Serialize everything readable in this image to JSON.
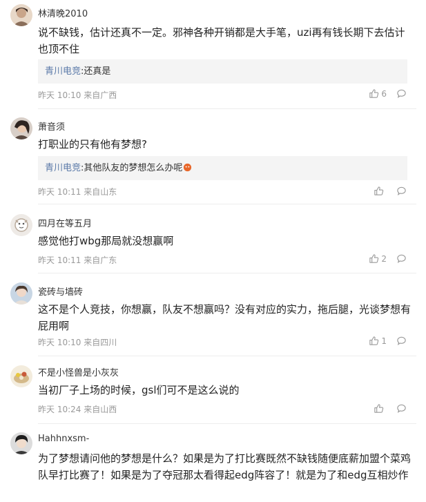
{
  "comments": [
    {
      "name": "林清晚2010",
      "text": "说不缺钱，估计还真不一定。邪神各种开销都是大手笔，uzi再有钱长期下去估计也顶不住",
      "reply": {
        "name": "青川电竞",
        "text": ":还真是"
      },
      "meta": "昨天 10:10 来自广西",
      "likes": "6",
      "avatar_color": "#c9a58a"
    },
    {
      "name": "萧音须",
      "text": "打职业的只有他有梦想?",
      "reply": {
        "name": "青川电竞",
        "text": ":其他队友的梦想怎么办呢"
      },
      "meta": "昨天 10:11 来自山东",
      "likes": "",
      "avatar_color": "#6b5a52"
    },
    {
      "name": "四月在等五月",
      "text": "感觉他打wbg那局就没想赢啊",
      "meta": "昨天 10:11 来自广东",
      "likes": "2",
      "avatar_color": "#b8a99a"
    },
    {
      "name": "瓷砖与墙砖",
      "text": "这不是个人竞技，你想赢，队友不想赢吗？没有对应的实力，拖后腿，光谈梦想有屁用啊",
      "meta": "昨天 10:10 来自四川",
      "likes": "1",
      "avatar_color": "#8fa3b8"
    },
    {
      "name": "不是小怪兽是小灰灰",
      "text": "当初厂子上场的时候，gsl们可不是这么说的",
      "meta": "昨天 10:24 来自山西",
      "likes": "",
      "avatar_color": "#d4b98a"
    },
    {
      "name": "Hahhnxsm-",
      "text": "为了梦想请问他的梦想是什么？如果是为了打比赛既然不缺钱随便底薪加盟个菜鸡队早打比赛了！如果是为了夺冠那太看得起edg阵容了！就是为了和edg互相炒作",
      "avatar_color": "#3a3a3a"
    }
  ],
  "icons": {
    "like": "thumbs-up-icon",
    "comment": "comment-bubble-icon",
    "emoji": "emoji-icon"
  }
}
